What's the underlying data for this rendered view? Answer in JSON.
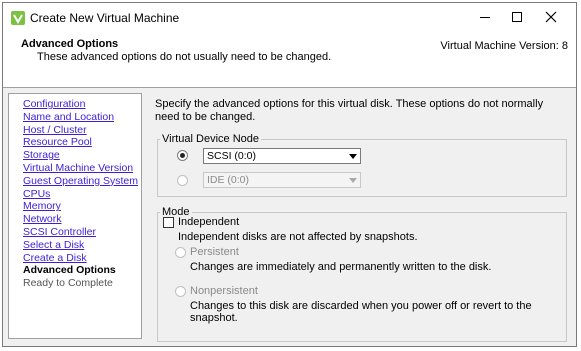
{
  "window": {
    "title": "Create New Virtual Machine",
    "controls": {
      "minimize": "—",
      "maximize": "☐",
      "close": "✕"
    }
  },
  "header": {
    "title": "Advanced Options",
    "subtitle": "These advanced options do not usually need to be changed.",
    "version": "Virtual Machine Version: 8"
  },
  "nav": {
    "items": [
      {
        "label": "Configuration",
        "state": "link"
      },
      {
        "label": "Name and Location",
        "state": "link"
      },
      {
        "label": "Host / Cluster",
        "state": "link"
      },
      {
        "label": "Resource Pool",
        "state": "link"
      },
      {
        "label": "Storage",
        "state": "link"
      },
      {
        "label": "Virtual Machine Version",
        "state": "link"
      },
      {
        "label": "Guest Operating System",
        "state": "link"
      },
      {
        "label": "CPUs",
        "state": "link"
      },
      {
        "label": "Memory",
        "state": "link"
      },
      {
        "label": "Network",
        "state": "link"
      },
      {
        "label": "SCSI Controller",
        "state": "link"
      },
      {
        "label": "Select a Disk",
        "state": "link"
      },
      {
        "label": "Create a Disk",
        "state": "link"
      },
      {
        "label": "Advanced Options",
        "state": "current"
      },
      {
        "label": "Ready to Complete",
        "state": "future"
      }
    ]
  },
  "content": {
    "intro": "Specify the advanced options for this virtual disk. These options do not normally need to be changed.",
    "virtual_device_node": {
      "legend": "Virtual Device Node",
      "scsi_value": "SCSI (0:0)",
      "ide_value": "IDE (0:0)"
    },
    "mode": {
      "legend": "Mode",
      "independent_label": "Independent",
      "independent_desc": "Independent disks are not affected by snapshots.",
      "persistent_label": "Persistent",
      "persistent_desc": "Changes are immediately and permanently written to the disk.",
      "nonpersistent_label": "Nonpersistent",
      "nonpersistent_desc_line1": "Changes to this disk are discarded when you power off or revert to the",
      "nonpersistent_desc_line2": "snapshot."
    }
  },
  "colors": {
    "link": "#3b1fd6",
    "window_bg": "#f0f0f0",
    "icon_green": "#7cc242"
  }
}
